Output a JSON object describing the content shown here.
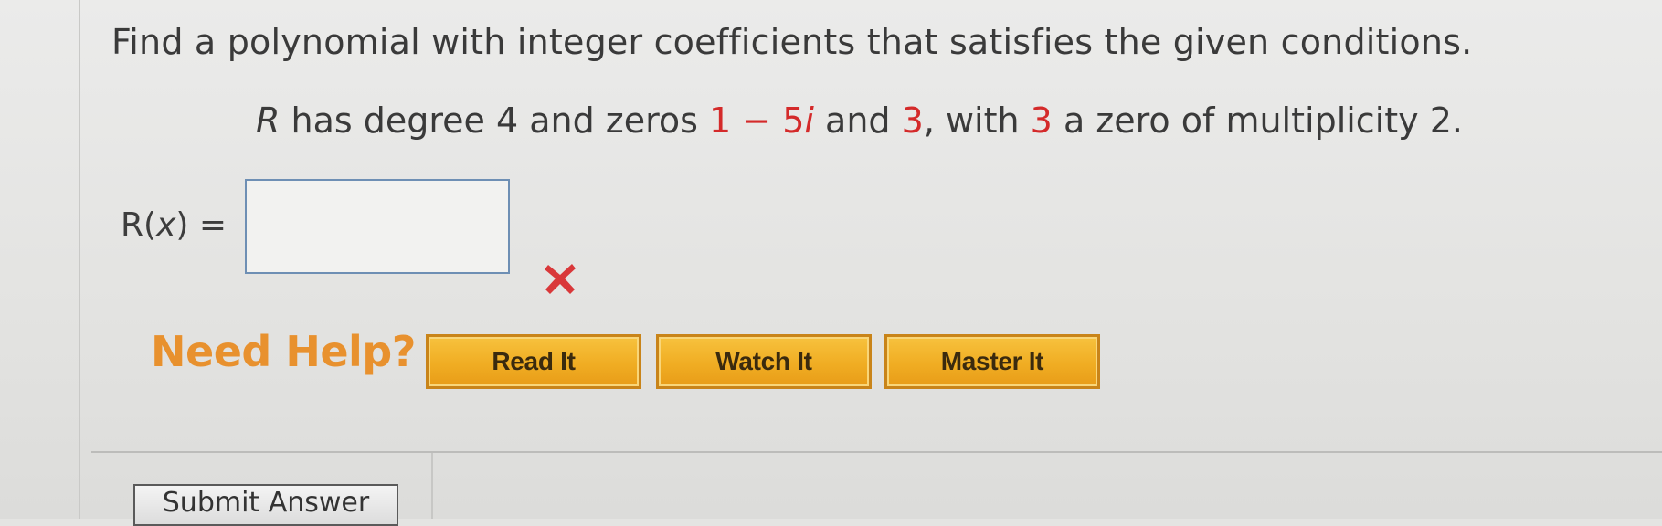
{
  "question": {
    "instruction": "Find a polynomial with integer coefficients that satisfies the given conditions.",
    "condition": {
      "var": "R",
      "text_1": " has degree 4 and zeros ",
      "zero_1_real": "1 − 5",
      "zero_1_imag": "i",
      "text_2": " and ",
      "zero_2": "3",
      "text_3": ", with ",
      "zero_3": "3",
      "text_4": " a zero of multiplicity 2."
    }
  },
  "answer": {
    "label_prefix": "R(",
    "label_var": "x",
    "label_suffix": ") =",
    "value": "",
    "status_icon": "red-x-icon",
    "status_color": "#d9383a"
  },
  "help": {
    "label": "Need Help?",
    "label_color": "#e8912e",
    "buttons": [
      {
        "label": "Read It"
      },
      {
        "label": "Watch It"
      },
      {
        "label": "Master It"
      }
    ],
    "button_color": "#f0ad23"
  },
  "submit": {
    "label": "Submit Answer"
  }
}
